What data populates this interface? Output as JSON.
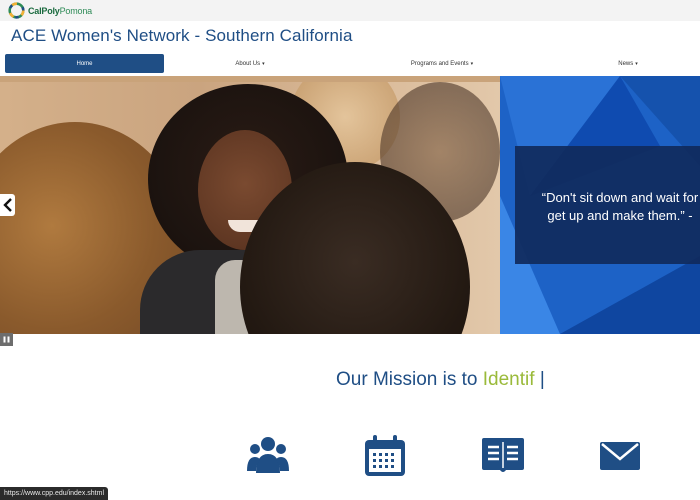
{
  "brand": {
    "logo_text_a": "CalPoly",
    "logo_text_b": "Pomona",
    "logo_icon": "cpp-octagon-logo-icon"
  },
  "site_title": "ACE Women's Network - Southern California",
  "nav": {
    "items": [
      {
        "label": "Home",
        "active": true
      },
      {
        "label": "About Us",
        "dropdown": true
      },
      {
        "label": "Programs and Events",
        "dropdown": true
      },
      {
        "label": "News",
        "dropdown": true
      }
    ]
  },
  "hero": {
    "quote_line1": "“Don't sit down and wait for",
    "quote_line2": "get up and make them.” -",
    "prev_icon": "chevron-left-icon",
    "pause_icon": "pause-icon"
  },
  "mission": {
    "prefix": "Our Mission is to ",
    "highlight": "Identif",
    "cursor": "|"
  },
  "features": {
    "icons": [
      "people-group-icon",
      "calendar-icon",
      "open-book-icon",
      "envelope-icon"
    ]
  },
  "status_bar": {
    "url": "https://www.cpp.edu/index.shtml"
  },
  "colors": {
    "primary": "#1f4e85",
    "accent_green": "#9aba3a",
    "panel_blue": "#1d62c6",
    "quote_box": "#102a5c"
  }
}
